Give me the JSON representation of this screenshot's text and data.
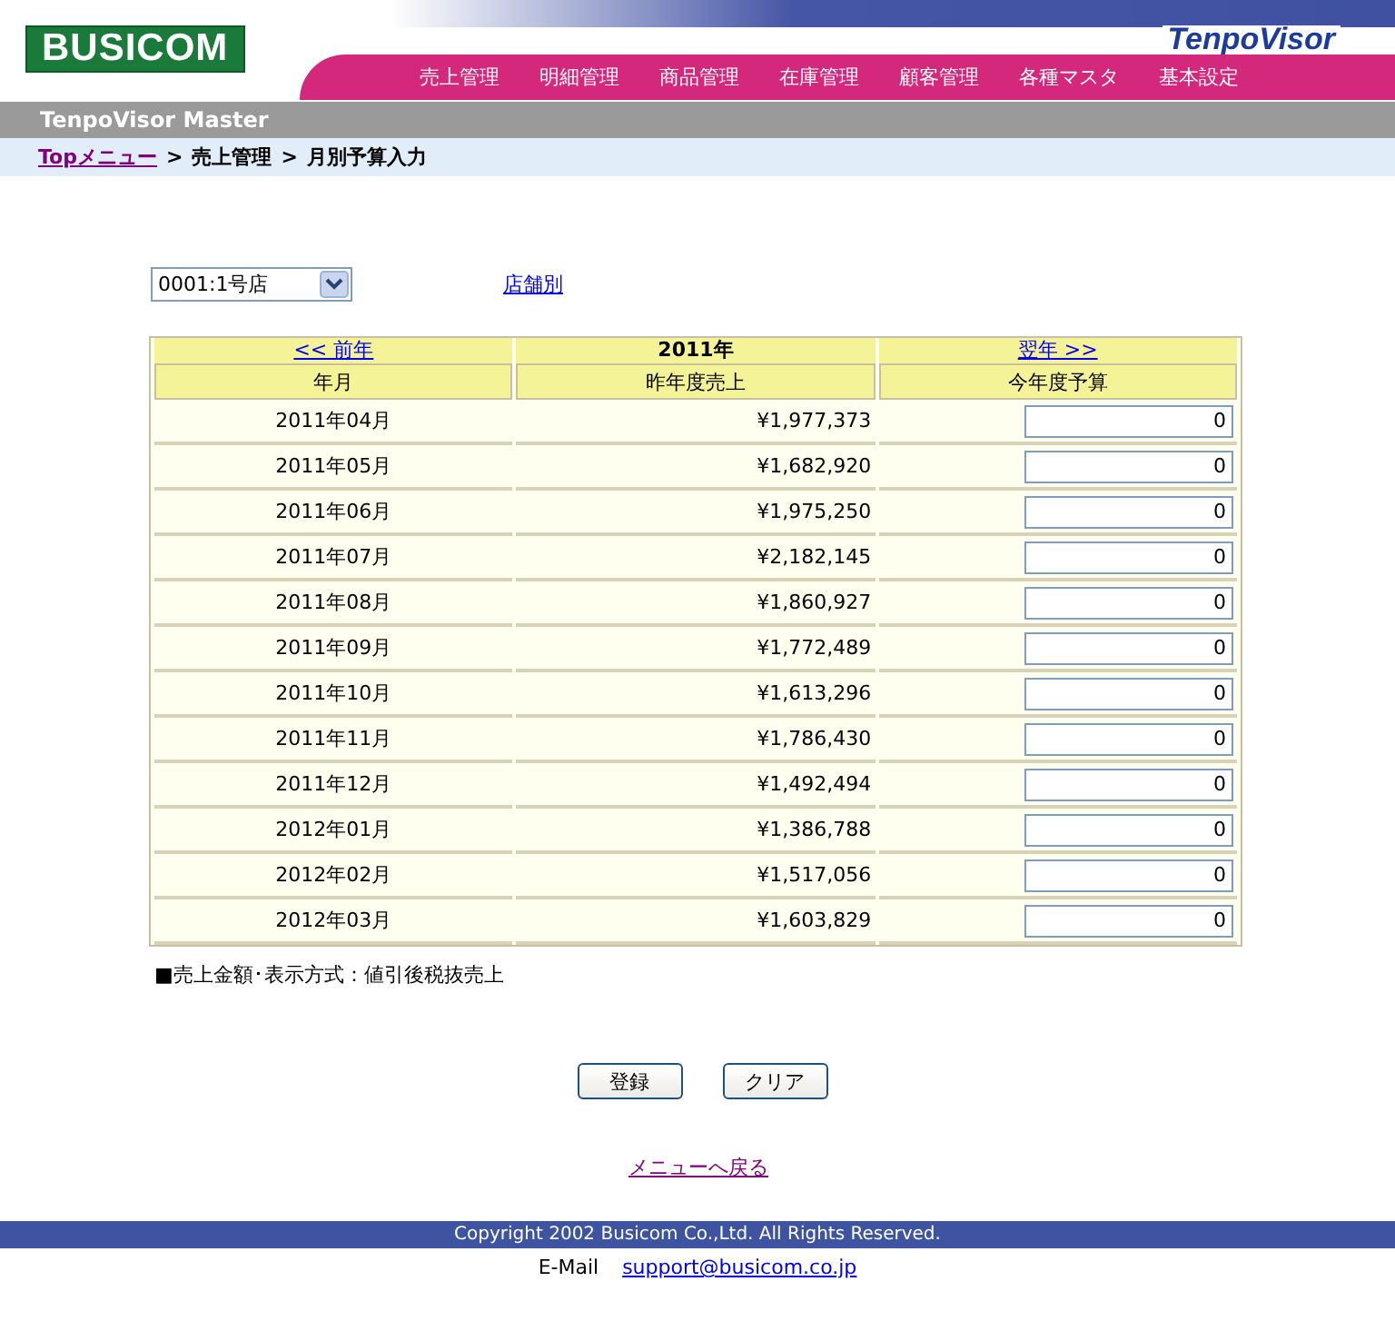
{
  "header": {
    "logo": "BUSICOM",
    "brand": "TenpoVisor",
    "nav": [
      "売上管理",
      "明細管理",
      "商品管理",
      "在庫管理",
      "顧客管理",
      "各種マスタ",
      "基本設定"
    ]
  },
  "app_title": "TenpoVisor Master",
  "breadcrumb": {
    "link": "Topメニュー",
    "separator": ">",
    "items": [
      "売上管理",
      "月別予算入力"
    ]
  },
  "store_select": {
    "value": "0001:1号店"
  },
  "store_link": "店舗別",
  "table": {
    "prev": "<< 前年",
    "year": "2011年",
    "next": "翌年 >>",
    "columns": [
      "年月",
      "昨年度売上",
      "今年度予算"
    ],
    "rows": [
      {
        "month": "2011年04月",
        "last_year": "¥1,977,373",
        "budget": "0"
      },
      {
        "month": "2011年05月",
        "last_year": "¥1,682,920",
        "budget": "0"
      },
      {
        "month": "2011年06月",
        "last_year": "¥1,975,250",
        "budget": "0"
      },
      {
        "month": "2011年07月",
        "last_year": "¥2,182,145",
        "budget": "0"
      },
      {
        "month": "2011年08月",
        "last_year": "¥1,860,927",
        "budget": "0"
      },
      {
        "month": "2011年09月",
        "last_year": "¥1,772,489",
        "budget": "0"
      },
      {
        "month": "2011年10月",
        "last_year": "¥1,613,296",
        "budget": "0"
      },
      {
        "month": "2011年11月",
        "last_year": "¥1,786,430",
        "budget": "0"
      },
      {
        "month": "2011年12月",
        "last_year": "¥1,492,494",
        "budget": "0"
      },
      {
        "month": "2012年01月",
        "last_year": "¥1,386,788",
        "budget": "0"
      },
      {
        "month": "2012年02月",
        "last_year": "¥1,517,056",
        "budget": "0"
      },
      {
        "month": "2012年03月",
        "last_year": "¥1,603,829",
        "budget": "0"
      }
    ]
  },
  "note": "■売上金額･表示方式：値引後税抜売上",
  "buttons": [
    "登録",
    "クリア"
  ],
  "back_link": "メニューへ戻る",
  "footer": {
    "copyright": "Copyright 2002 Busicom Co.,Ltd. All Rights Reserved.",
    "email_label": "E-Mail",
    "email": "support@busicom.co.jp"
  }
}
